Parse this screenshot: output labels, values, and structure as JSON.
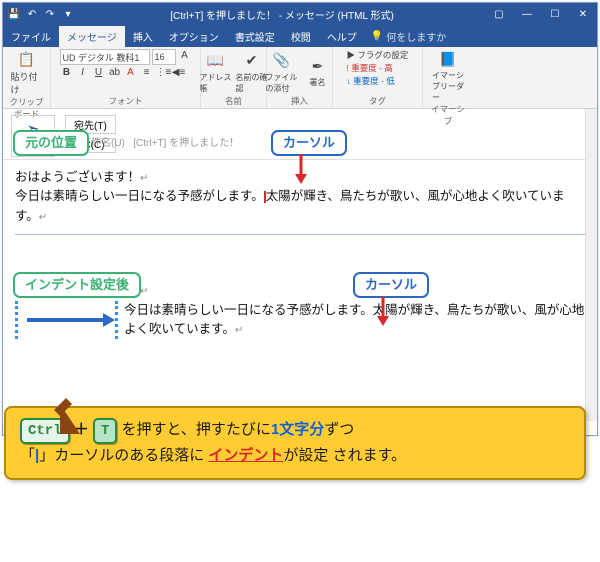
{
  "titlebar": {
    "title": "[Ctrl+T] を押しました！ - メッセージ (HTML 形式)"
  },
  "tabs": {
    "file": "ファイル",
    "message": "メッセージ",
    "insert": "挿入",
    "options": "オプション",
    "format": "書式設定",
    "review": "校閲",
    "help": "ヘルプ",
    "tell": "何をしますか"
  },
  "ribbon": {
    "clipboard": {
      "paste": "貼り付け",
      "label": "クリップボード"
    },
    "font": {
      "name": "UD デジタル 教科1",
      "size": "16",
      "label": "フォント"
    },
    "names": {
      "address": "アドレス帳",
      "check": "名前の確認",
      "label": "名前"
    },
    "include": {
      "attach": "ファイルの添付",
      "sign": "署名",
      "label": "挿入"
    },
    "tags": {
      "flag": "フラグの設定",
      "hi": "重要度 - 高",
      "lo": "重要度 - 低",
      "label": "タグ"
    },
    "immersive": {
      "reader": "イマーシブリーダー",
      "label": "イマーシブ"
    }
  },
  "send": {
    "send": "送信(S)",
    "to": "宛先(T)",
    "cc": "CC(C)"
  },
  "subject": {
    "label": "件名(U)",
    "value": "[Ctrl+T] を押しました！"
  },
  "body": {
    "label_original": "元の位置",
    "label_cursor": "カーソル",
    "greeting": "おはようございます！",
    "line2a": "今日は素晴らしい一日になる予感がします。",
    "line2b": "太陽が輝き、鳥たちが歌い、風が心地よく吹いています。",
    "label_after": "インデント設定後",
    "indent_line": "今日は素晴らしい一日になる予感がします。太陽が輝き、鳥たちが歌い、風が心地よく吹いています。"
  },
  "callout": {
    "key1": "Ctrl",
    "key2": "T",
    "text1": " を押すと、押すたびに",
    "blue": "1文字分",
    "text2": "ずつ",
    "line2a": "「",
    "cursor_char": "|",
    "line2b": "」カーソルのある段落に ",
    "red": "インデント",
    "line2c": "が設定 されます。"
  }
}
